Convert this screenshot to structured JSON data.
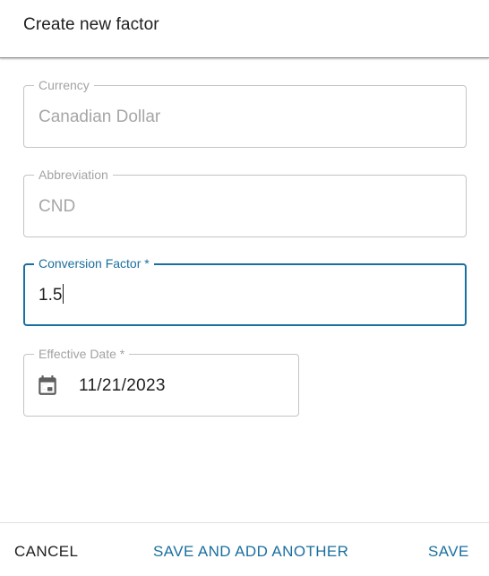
{
  "dialog": {
    "title": "Create new factor"
  },
  "fields": {
    "currency": {
      "label": "Currency",
      "value": "Canadian Dollar"
    },
    "abbreviation": {
      "label": "Abbreviation",
      "value": "CND"
    },
    "conversion_factor": {
      "label": "Conversion Factor *",
      "value": "1.5"
    },
    "effective_date": {
      "label": "Effective Date *",
      "value": "11/21/2023",
      "icon": "calendar-icon"
    }
  },
  "footer": {
    "cancel_label": "CANCEL",
    "save_and_add_label": "SAVE AND ADD ANOTHER",
    "save_label": "SAVE"
  },
  "colors": {
    "accent": "#1a6f9e",
    "disabled_text": "#a6a6a6",
    "border": "#c4c4c4"
  }
}
